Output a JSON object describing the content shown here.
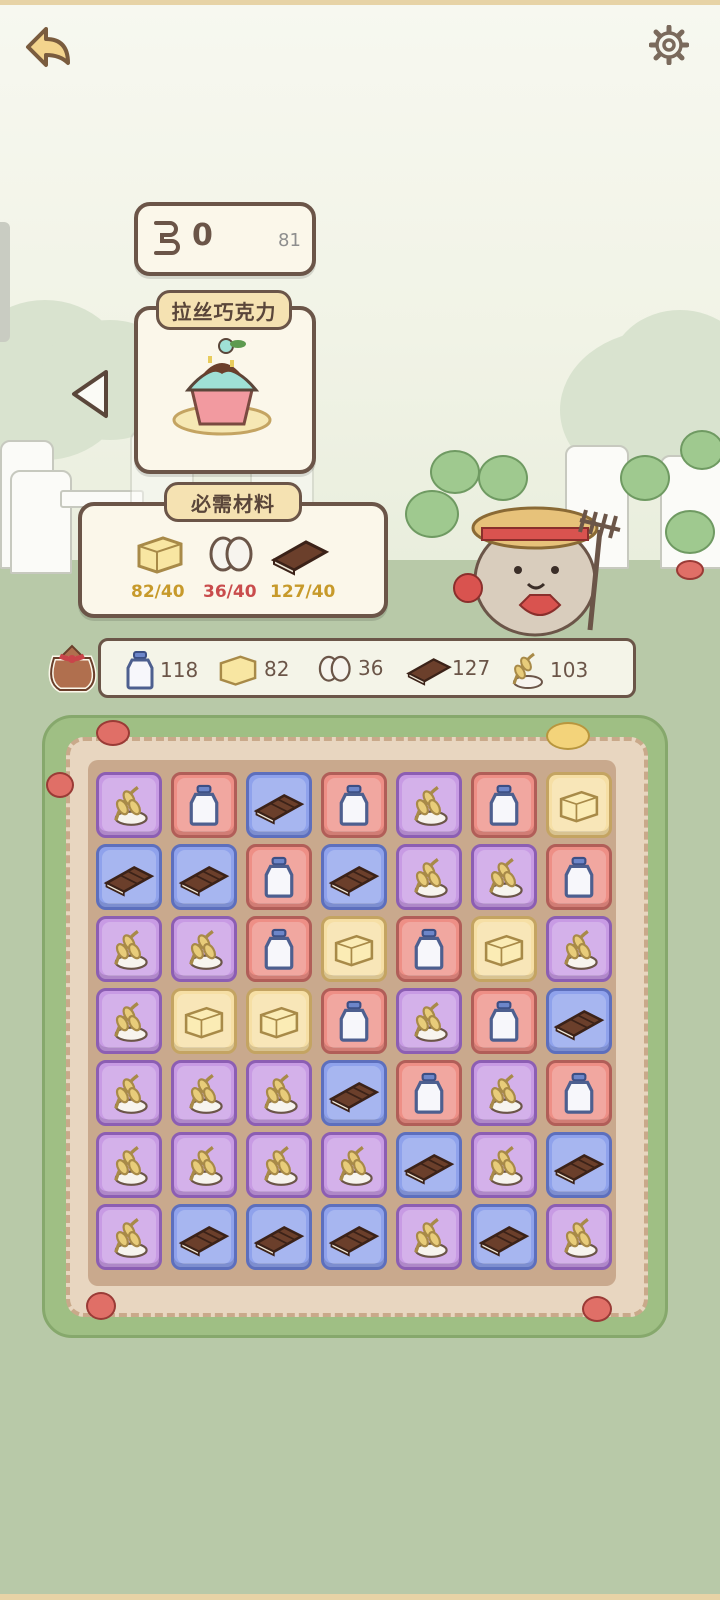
{
  "header": {
    "back_icon": "back-arrow-icon",
    "settings_icon": "gear-icon"
  },
  "moves": {
    "icon": "footprint-icon",
    "value": "0",
    "max": "81"
  },
  "recipe": {
    "name": "拉丝巧克力",
    "dish_icon": "cupcake-icon",
    "prev_icon": "triangle-left-icon"
  },
  "requirements": {
    "title": "必需材料",
    "items": [
      {
        "icon": "butter-icon",
        "amount": "82/40",
        "color": "#c79a2b"
      },
      {
        "icon": "egg-icon",
        "amount": "36/40",
        "color": "#c94c4c"
      },
      {
        "icon": "chocolate-icon",
        "amount": "127/40",
        "color": "#c79a2b"
      }
    ]
  },
  "inventory": {
    "bag_icon": "sack-icon",
    "items": [
      {
        "icon": "milk-icon",
        "value": "118"
      },
      {
        "icon": "butter-icon",
        "value": "82"
      },
      {
        "icon": "egg-icon",
        "value": "36"
      },
      {
        "icon": "chocolate-icon",
        "value": "127"
      },
      {
        "icon": "wheat-icon",
        "value": "103"
      }
    ]
  },
  "board": {
    "rows": [
      [
        "wheat",
        "milk",
        "choc",
        "milk",
        "wheat",
        "milk",
        "butter"
      ],
      [
        "choc",
        "choc",
        "milk",
        "choc",
        "wheat",
        "wheat",
        "milk"
      ],
      [
        "wheat",
        "wheat",
        "milk",
        "butter",
        "milk",
        "butter",
        "wheat"
      ],
      [
        "wheat",
        "butter",
        "butter",
        "milk",
        "wheat",
        "milk",
        "choc"
      ],
      [
        "wheat",
        "wheat",
        "wheat",
        "choc",
        "milk",
        "wheat",
        "milk"
      ],
      [
        "wheat",
        "wheat",
        "wheat",
        "wheat",
        "choc",
        "wheat",
        "choc"
      ],
      [
        "wheat",
        "choc",
        "choc",
        "choc",
        "wheat",
        "choc",
        "wheat"
      ]
    ]
  },
  "colors": {
    "panel_border": "#6b5548",
    "wheat_tile": "#c89be4",
    "milk_tile": "#ee8f86",
    "choc_tile": "#8fa2ec",
    "butter_tile": "#f6dfa5"
  }
}
